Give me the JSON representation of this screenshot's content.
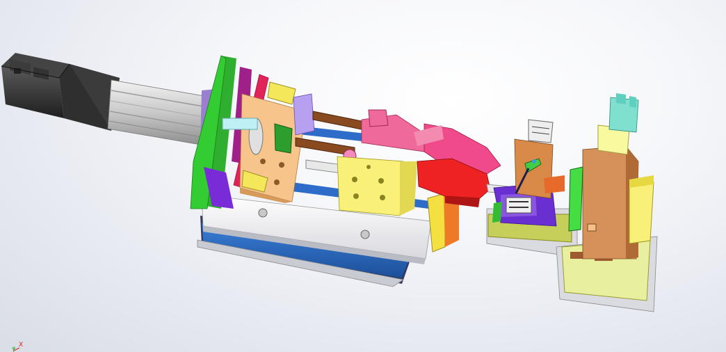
{
  "viewport": {
    "background_top": "#ffffff",
    "background_bottom": "#d9dde6"
  },
  "model": {
    "parts": [
      "servo-motor",
      "electric-cylinder",
      "green-end-plate",
      "magenta-side-plate",
      "red-mounting-plate",
      "orange-slide-block",
      "lavender-bearing-block",
      "brown-guide-rods",
      "pink-clamp-assembly",
      "yellow-carriage",
      "blue-linear-rails",
      "white-base-plate",
      "blue-base-block",
      "red-gripper-jaws",
      "orange-carrier-block",
      "purple-fixture-base",
      "green-test-probe",
      "copper-press-block",
      "teal-air-cylinder",
      "olive-base-block"
    ]
  },
  "triad": {
    "y_label": "Y",
    "x_label": "X",
    "y_color": "#33aa33",
    "x_color": "#dd2222"
  }
}
